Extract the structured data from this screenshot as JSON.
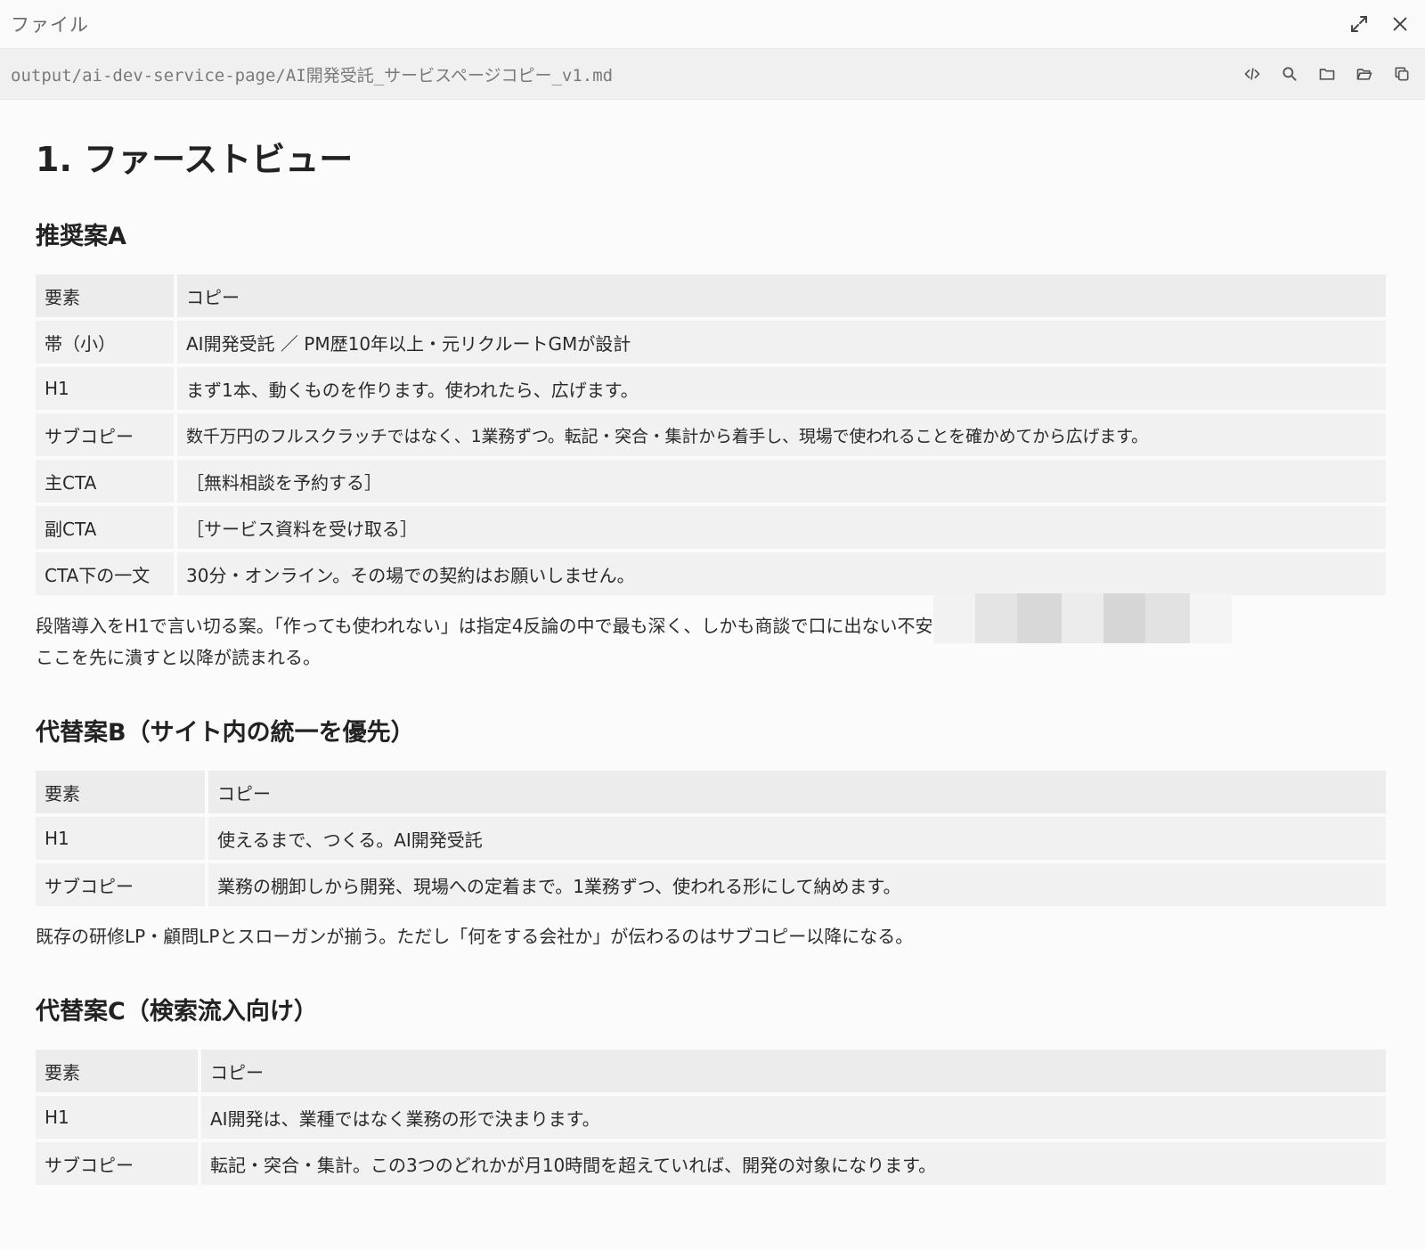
{
  "window": {
    "title": "ファイル"
  },
  "path_bar": {
    "path": "output/ai-dev-service-page/AI開発受託_サービスページコピー_v1.md"
  },
  "doc": {
    "h1": "1. ファーストビュー",
    "section_a": {
      "heading": "推奨案A",
      "header": [
        "要素",
        "コピー"
      ],
      "rows": [
        {
          "label": "帯（小）",
          "value": "AI開発受託 ／ PM歴10年以上・元リクルートGMが設計"
        },
        {
          "label": "H1",
          "value": "まず1本、動くものを作ります。使われたら、広げます。"
        },
        {
          "label": "サブコピー",
          "value": "数千万円のフルスクラッチではなく、1業務ずつ。転記・突合・集計から着手し、現場で使われることを確かめてから広げます。"
        },
        {
          "label": "主CTA",
          "value": "［無料相談を予約する］"
        },
        {
          "label": "副CTA",
          "value": "［サービス資料を受け取る］"
        },
        {
          "label": "CTA下の一文",
          "value": "30分・オンライン。その場での契約はお願いしません。"
        }
      ],
      "note_line1": "段階導入をH1で言い切る案。「作っても使われない」は指定4反論の中で最も深く、しかも商談で口に出ない不安",
      "note_line2": "ここを先に潰すと以降が読まれる。"
    },
    "section_b": {
      "heading": "代替案B（サイト内の統一を優先）",
      "header": [
        "要素",
        "コピー"
      ],
      "rows": [
        {
          "label": "H1",
          "value": "使えるまで、つくる。AI開発受託"
        },
        {
          "label": "サブコピー",
          "value": "業務の棚卸しから開発、現場への定着まで。1業務ずつ、使われる形にして納めます。"
        }
      ],
      "note": "既存の研修LP・顧問LPとスローガンが揃う。ただし「何をする会社か」が伝わるのはサブコピー以降になる。"
    },
    "section_c": {
      "heading": "代替案C（検索流入向け）",
      "header": [
        "要素",
        "コピー"
      ],
      "rows": [
        {
          "label": "H1",
          "value": "AI開発は、業種ではなく業務の形で決まります。"
        },
        {
          "label": "サブコピー",
          "value": "転記・突合・集計。この3つのどれかが月10時間を超えていれば、開発の対象になります。"
        }
      ]
    }
  }
}
